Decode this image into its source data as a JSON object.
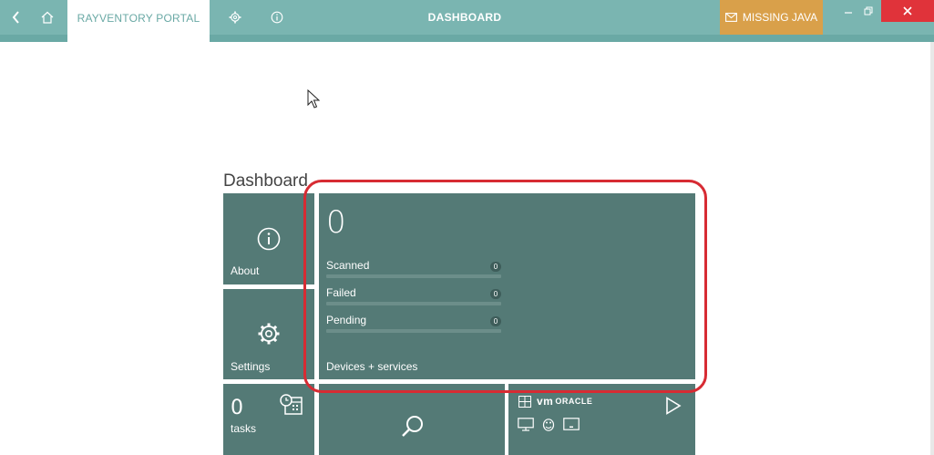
{
  "titlebar": {
    "tab_label": "RAYVENTORY PORTAL",
    "title": "DASHBOARD",
    "missing_java_label": "MISSING JAVA"
  },
  "dashboard": {
    "heading": "Dashboard",
    "about": {
      "label": "About"
    },
    "settings": {
      "label": "Settings"
    },
    "tasks": {
      "count": "0",
      "label": "tasks"
    },
    "devices": {
      "total": "0",
      "label": "Devices + services",
      "stats": [
        {
          "label": "Scanned",
          "count": "0"
        },
        {
          "label": "Failed",
          "count": "0"
        },
        {
          "label": "Pending",
          "count": "0"
        }
      ]
    },
    "vm_tile": {
      "vm_brand": "vm",
      "oracle_brand": "ORACLE"
    }
  },
  "colors": {
    "titlebar": "#7ab5b1",
    "tile": "#547a76",
    "missing_java": "#d9a04a",
    "close": "#e0333a",
    "highlight": "#d72b33"
  },
  "icons": [
    "back-arrow-icon",
    "home-icon",
    "gear-icon",
    "info-icon",
    "mail-icon",
    "minimize-icon",
    "restore-icon",
    "close-icon",
    "search-icon",
    "calendar-clock-icon",
    "windows-icon",
    "play-icon",
    "monitor-icon",
    "linux-icon",
    "device-icon"
  ]
}
